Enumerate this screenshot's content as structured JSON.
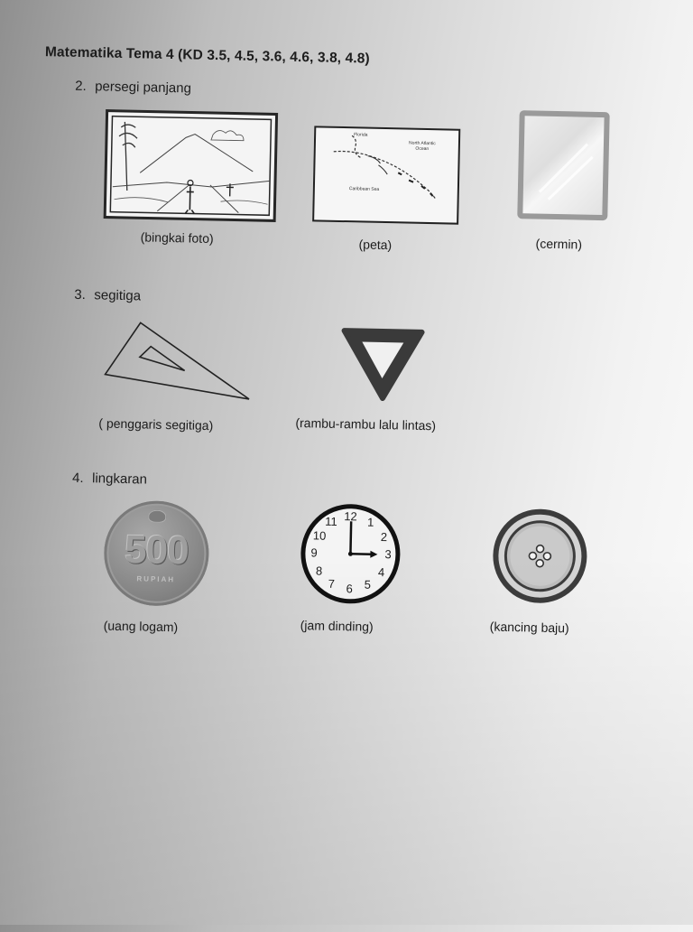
{
  "heading": "Matematika Tema 4 (KD 3.5, 4.5, 3.6, 4.6, 3.8, 4.8)",
  "sections": [
    {
      "number": "2.",
      "name": "persegi panjang",
      "items": [
        {
          "caption": "(bingkai foto)",
          "icon": "photo-frame-icon"
        },
        {
          "caption": "(peta)",
          "icon": "map-icon"
        },
        {
          "caption": "(cermin)",
          "icon": "mirror-icon"
        }
      ]
    },
    {
      "number": "3.",
      "name": "segitiga",
      "items": [
        {
          "caption": "( penggaris segitiga)",
          "icon": "triangle-ruler-icon"
        },
        {
          "caption": "(rambu-rambu lalu lintas)",
          "icon": "yield-sign-icon"
        }
      ]
    },
    {
      "number": "4.",
      "name": "lingkaran",
      "items": [
        {
          "caption": "(uang logam)",
          "icon": "coin-icon"
        },
        {
          "caption": "(jam dinding)",
          "icon": "wall-clock-icon"
        },
        {
          "caption": "(kancing baju)",
          "icon": "button-icon"
        }
      ]
    }
  ],
  "map_labels": {
    "caribbean": "Caribbean Sea",
    "ocean": "North Atlantic Ocean",
    "florida": "Florida"
  },
  "coin_value": "500",
  "coin_unit": "RUPIAH",
  "clock_numbers": [
    "12",
    "1",
    "2",
    "3",
    "4",
    "5",
    "6",
    "7",
    "8",
    "9",
    "10",
    "11"
  ],
  "colors": {
    "ink": "#1d1d1d",
    "frame": "#2a2a2a",
    "mirror_frame": "#9a9a9a",
    "coin": "#8a8a8a",
    "sign": "#3a3a3a",
    "button_rim": "#3c3c3c"
  }
}
